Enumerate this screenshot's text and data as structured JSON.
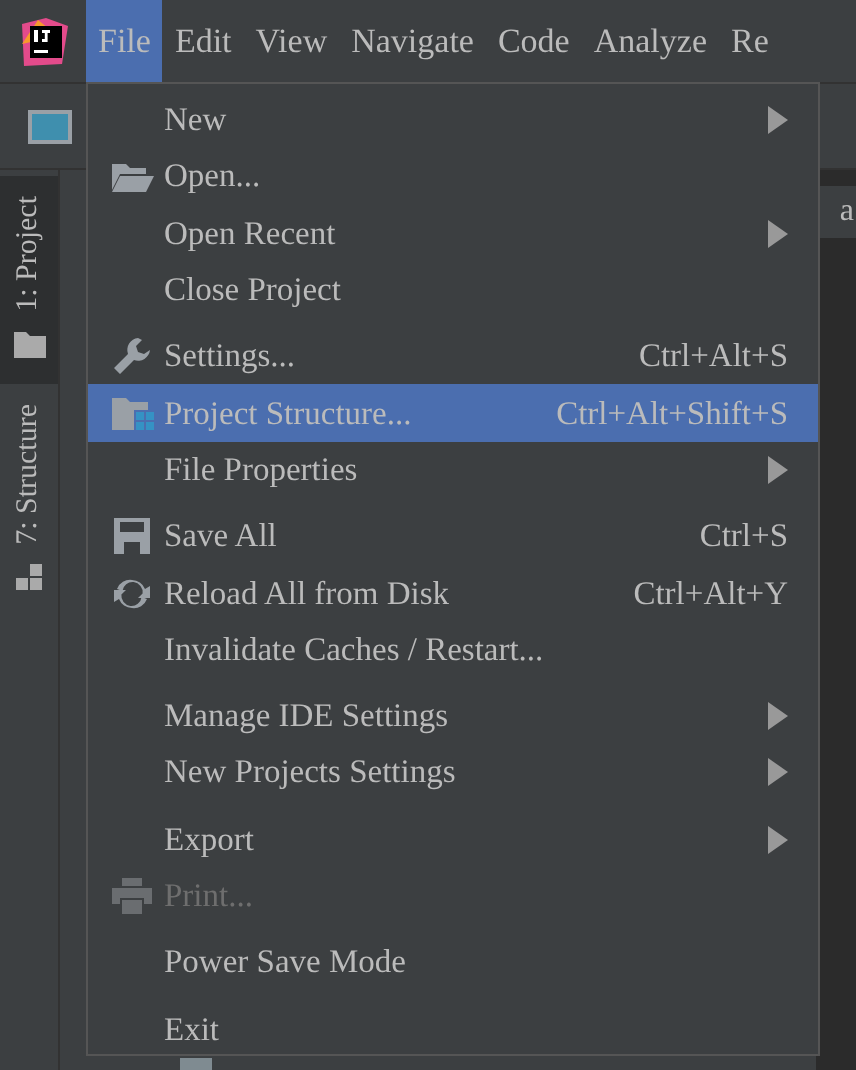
{
  "menubar": [
    {
      "label": "File",
      "selected": true
    },
    {
      "label": "Edit",
      "selected": false
    },
    {
      "label": "View",
      "selected": false
    },
    {
      "label": "Navigate",
      "selected": false
    },
    {
      "label": "Code",
      "selected": false
    },
    {
      "label": "Analyze",
      "selected": false
    },
    {
      "label": "Re",
      "selected": false
    }
  ],
  "tool_windows": [
    {
      "label": "1: Project",
      "selected": true
    },
    {
      "label": "7: Structure",
      "selected": false
    }
  ],
  "editor_tab": "a",
  "file_menu": [
    [
      {
        "label": "New",
        "submenu": true,
        "selected": false,
        "disabled": false
      },
      {
        "label": "Open...",
        "submenu": false,
        "selected": false,
        "disabled": false
      },
      {
        "label": "Open Recent",
        "submenu": true,
        "selected": false,
        "disabled": false
      },
      {
        "label": "Close Project",
        "submenu": false,
        "selected": false,
        "disabled": false
      }
    ],
    [
      {
        "label": "Settings...",
        "shortcut": "Ctrl+Alt+S",
        "submenu": false,
        "selected": false,
        "disabled": false
      },
      {
        "label": "Project Structure...",
        "shortcut": "Ctrl+Alt+Shift+S",
        "submenu": false,
        "selected": true,
        "disabled": false
      },
      {
        "label": "File Properties",
        "submenu": true,
        "selected": false,
        "disabled": false
      }
    ],
    [
      {
        "label": "Save All",
        "shortcut": "Ctrl+S",
        "submenu": false,
        "selected": false,
        "disabled": false
      },
      {
        "label": "Reload All from Disk",
        "shortcut": "Ctrl+Alt+Y",
        "submenu": false,
        "selected": false,
        "disabled": false
      },
      {
        "label": "Invalidate Caches / Restart...",
        "submenu": false,
        "selected": false,
        "disabled": false
      }
    ],
    [
      {
        "label": "Manage IDE Settings",
        "submenu": true,
        "selected": false,
        "disabled": false
      },
      {
        "label": "New Projects Settings",
        "submenu": true,
        "selected": false,
        "disabled": false
      }
    ],
    [
      {
        "label": "Export",
        "submenu": true,
        "selected": false,
        "disabled": false
      },
      {
        "label": "Print...",
        "submenu": false,
        "selected": false,
        "disabled": true
      }
    ],
    [
      {
        "label": "Power Save Mode",
        "submenu": false,
        "selected": false,
        "disabled": false
      }
    ],
    [
      {
        "label": "Exit",
        "submenu": false,
        "selected": false,
        "disabled": false
      }
    ]
  ]
}
